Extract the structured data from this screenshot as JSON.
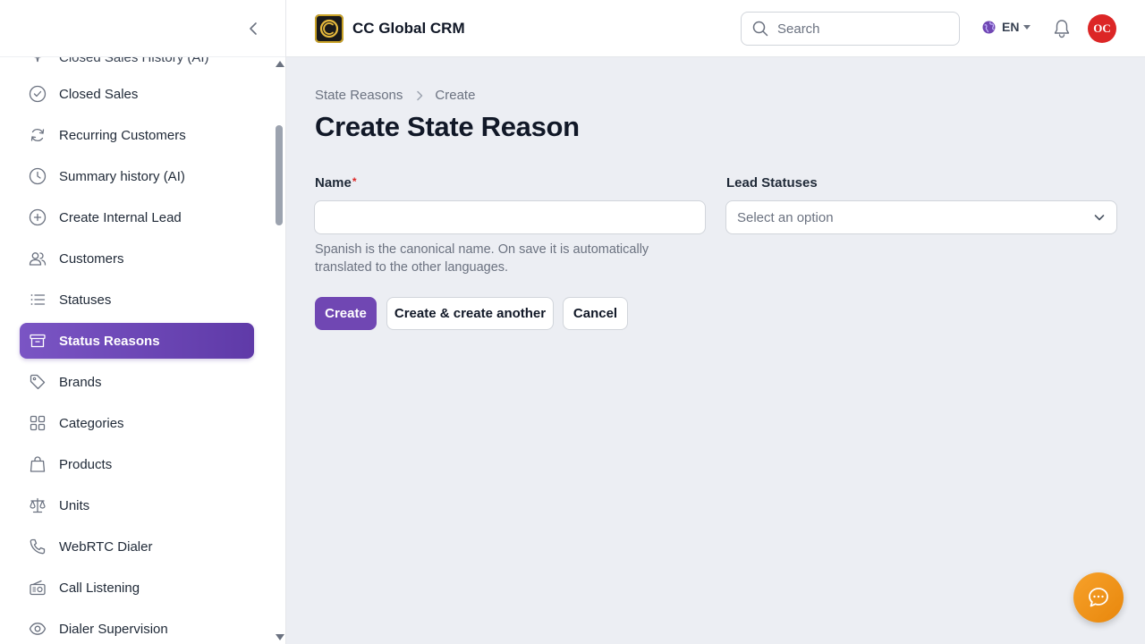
{
  "app": {
    "name": "CC Global CRM",
    "brand_color": "#7047b3"
  },
  "header": {
    "search_placeholder": "Search",
    "language": "EN",
    "avatar_initials": "OC"
  },
  "sidebar": {
    "partial_item_label": "Closed Sales History (AI)",
    "items": [
      {
        "label": "Closed Sales",
        "icon": "check-circle-icon"
      },
      {
        "label": "Recurring Customers",
        "icon": "refresh-icon"
      },
      {
        "label": "Summary history (AI)",
        "icon": "clock-icon"
      },
      {
        "label": "Create Internal Lead",
        "icon": "plus-circle-icon"
      },
      {
        "label": "Customers",
        "icon": "users-icon"
      },
      {
        "label": "Statuses",
        "icon": "list-icon"
      },
      {
        "label": "Status Reasons",
        "icon": "archive-icon",
        "active": true
      },
      {
        "label": "Brands",
        "icon": "tag-icon"
      },
      {
        "label": "Categories",
        "icon": "grid-icon"
      },
      {
        "label": "Products",
        "icon": "shopping-bag-icon"
      },
      {
        "label": "Units",
        "icon": "scale-icon"
      },
      {
        "label": "WebRTC Dialer",
        "icon": "phone-icon"
      },
      {
        "label": "Call Listening",
        "icon": "radio-icon"
      },
      {
        "label": "Dialer Supervision",
        "icon": "eye-icon"
      }
    ]
  },
  "main": {
    "breadcrumb": [
      "State Reasons",
      "Create"
    ],
    "title": "Create State Reason",
    "form": {
      "name_label": "Name",
      "name_required_mark": "*",
      "name_value": "",
      "help_text": "Spanish is the canonical name. On save it is automatically translated to the other languages.",
      "lead_statuses_label": "Lead Statuses",
      "lead_statuses_placeholder": "Select an option"
    },
    "buttons": {
      "create": "Create",
      "create_another": "Create & create another",
      "cancel": "Cancel"
    }
  }
}
